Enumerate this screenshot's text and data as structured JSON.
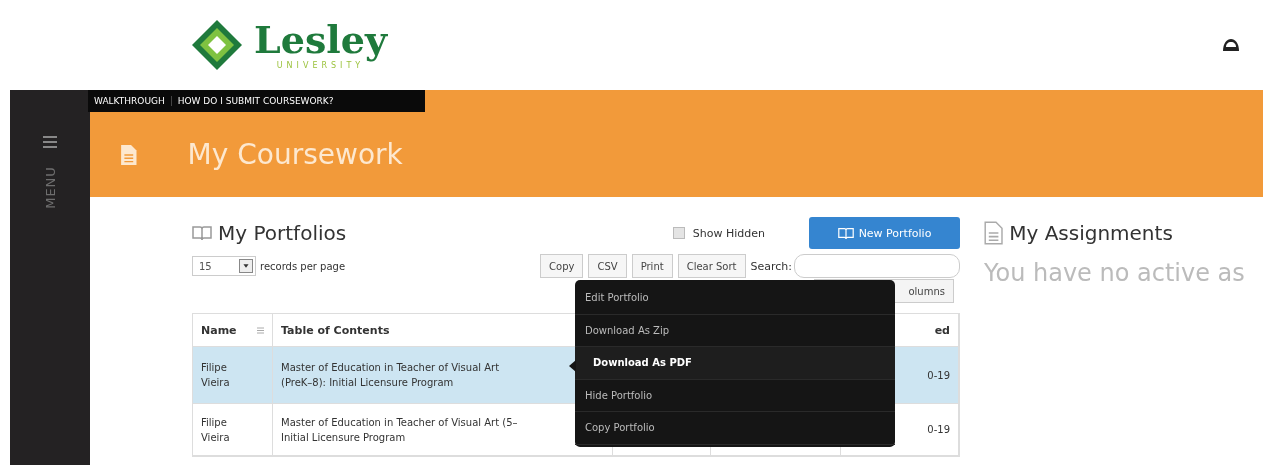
{
  "header": {
    "logo": {
      "name": "Lesley",
      "subtitle": "UNIVERSITY"
    }
  },
  "help_bar": {
    "links": [
      "WALKTHROUGH",
      "HOW DO I SUBMIT COURSEWORK?"
    ]
  },
  "sidebar": {
    "label": "MENU"
  },
  "page_title": "My Coursework",
  "portfolios": {
    "title": "My Portfolios",
    "show_hidden": {
      "label": "Show Hidden",
      "checked": false
    },
    "new_button": "New Portfolio",
    "page_size": "15",
    "page_size_label": "records per page",
    "export_buttons": [
      "Copy",
      "CSV",
      "Print",
      "Clear Sort"
    ],
    "search_label": "Search:",
    "columns_button": "olumns",
    "table": {
      "columns": [
        "Name",
        "Table of Contents"
      ],
      "column_5": "ed",
      "rows": [
        {
          "name": "Filipe\nVieira",
          "contents": "Master of Education in Teacher of Visual Art\n(PreK–8): Initial Licensure Program",
          "column_5": "0-19",
          "selected": true
        },
        {
          "name": "Filipe\nVieira",
          "contents": "Master of Education in Teacher of Visual Art (5–\nInitial Licensure Program",
          "column_5": "0-19",
          "selected": false
        }
      ]
    },
    "menu": [
      {
        "label": "Edit Portfolio",
        "selected": false
      },
      {
        "label": "Download As Zip",
        "selected": false
      },
      {
        "label": "Download As PDF",
        "selected": true
      },
      {
        "label": "Hide Portfolio",
        "selected": false
      },
      {
        "label": "Copy Portfolio",
        "selected": false
      }
    ]
  },
  "assignments": {
    "title": "My Assignments",
    "message": "You have no active as"
  }
}
